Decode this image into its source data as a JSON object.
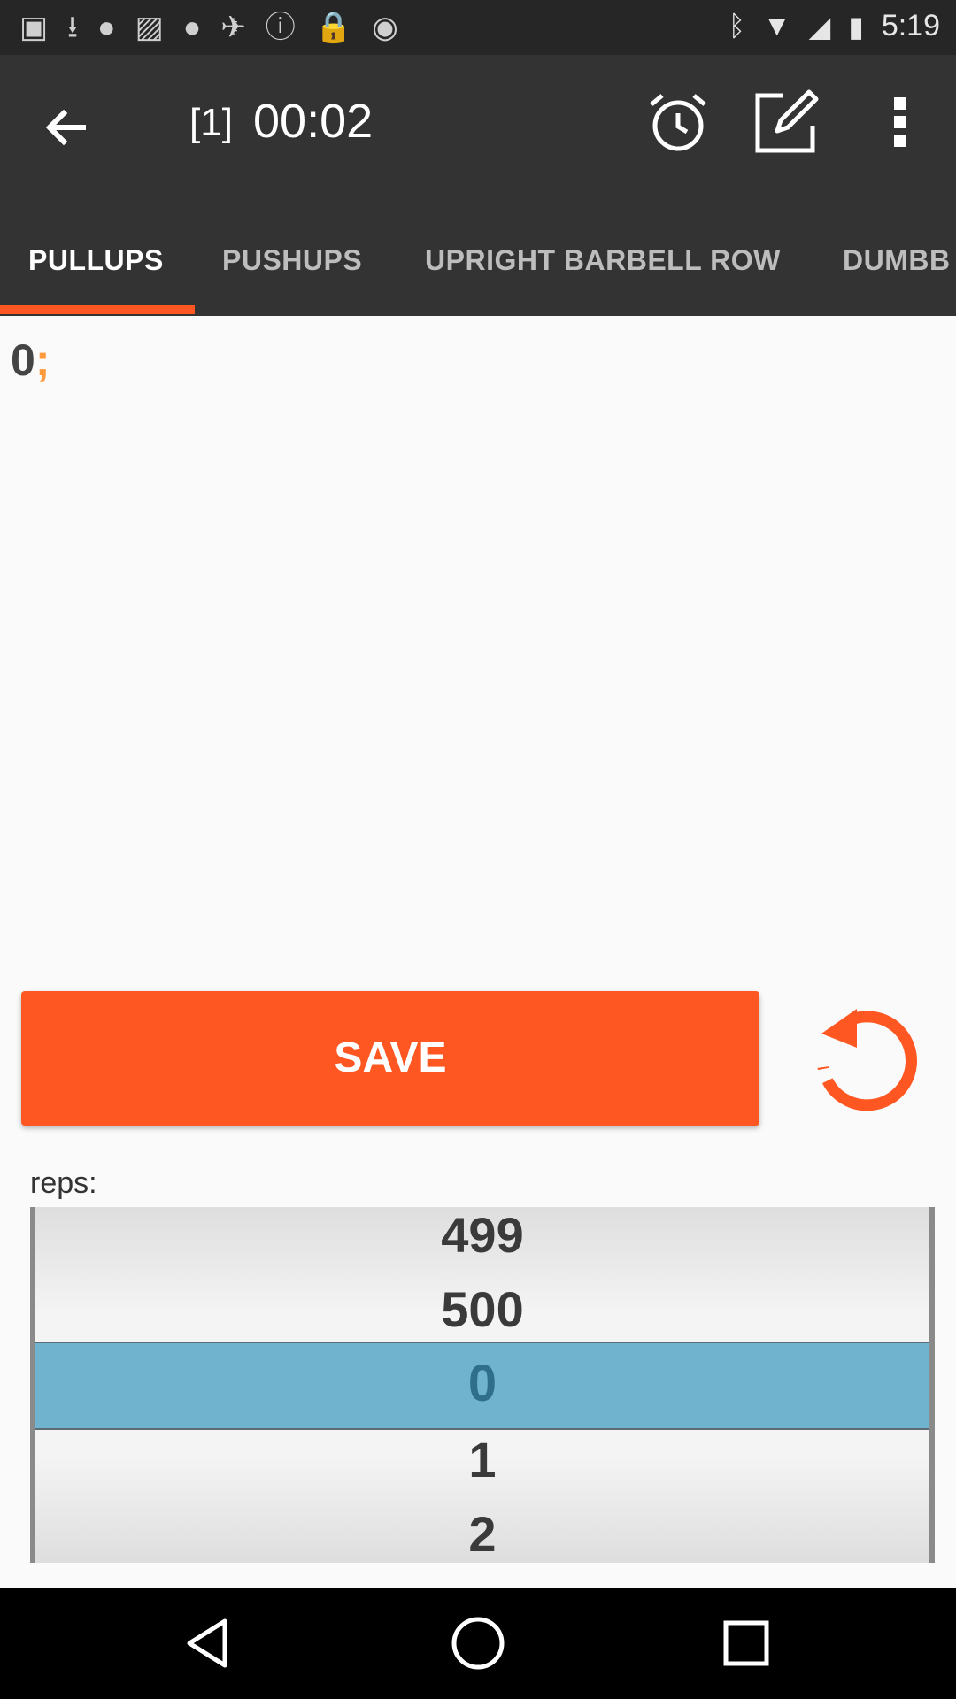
{
  "status_bar": {
    "time": "5:19",
    "left_icons": [
      "chat-dots-icon",
      "download-icon",
      "circle-icon",
      "image-icon",
      "circle-icon",
      "fake-gps-icon",
      "info-icon",
      "lock-icon",
      "cat-icon"
    ],
    "right_icons": [
      "bluetooth-icon",
      "wifi-icon",
      "signal-icon",
      "battery-icon"
    ]
  },
  "app_bar": {
    "set_number": "[1]",
    "timer": "00:02"
  },
  "tabs": [
    {
      "label": "PULLUPS",
      "active": true
    },
    {
      "label": "PUSHUPS",
      "active": false
    },
    {
      "label": "UPRIGHT BARBELL ROW",
      "active": false
    },
    {
      "label": "DUMBB",
      "active": false
    }
  ],
  "log": {
    "count": "0",
    "separator": ";"
  },
  "save_button": {
    "label": "SAVE"
  },
  "reps": {
    "label": "reps:",
    "items": [
      "499",
      "500",
      "0",
      "1",
      "2"
    ],
    "selected": "0"
  },
  "colors": {
    "accent": "#ff5722",
    "app_bar": "#333333",
    "picker_selection": "#6fb3cf"
  }
}
